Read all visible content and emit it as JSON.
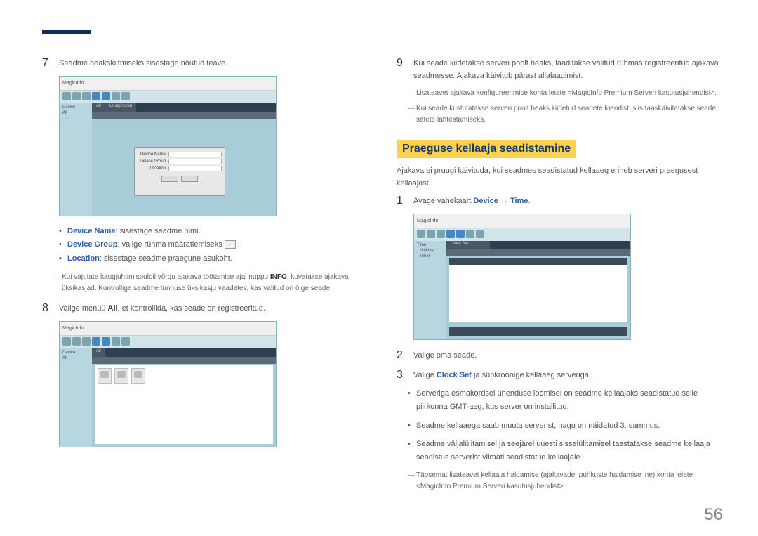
{
  "header": {},
  "left": {
    "step7": {
      "num": "7",
      "text": "Seadme heakskiitmiseks sisestage nõutud teave.",
      "bullets": {
        "b1_label": "Device Name",
        "b1_text": ": sisestage seadme nimi.",
        "b2_label": "Device Group",
        "b2_text": ": valige rühma määratlemiseks ",
        "b3_label": "Location",
        "b3_text": ": sisestage seadme praegune asukoht."
      },
      "note": "Kui vajutate kaugjuhtimispuldil võrgu ajakava töötamise ajal nuppu INFO, kuvatakse ajakava üksikasjad. Kontrollige seadme tunnuse üksikasju vaadates, kas valitud on õige seade.",
      "note_bold": "INFO"
    },
    "step8": {
      "num": "8",
      "text_a": "Valige menüü ",
      "bold": "All",
      "text_b": ", et kontrollida, kas seade on registreeritud."
    },
    "shot_app": "MagicInfo"
  },
  "right": {
    "step9": {
      "num": "9",
      "text_a": "Kui seade kiidetakse serveri poolt heaks, laaditakse valitud rühmas registreeritud ajakava seadmesse. Ajakava käivitub pärast allalaadimist.",
      "note1": "Lisateavet ajakava konfigureerimise kohta leiate <MagicInfo Premium Serveri kasutusjuhendist>.",
      "note2": "Kui seade kustutatakse serveri poolt heaks kiidetud seadete loendist, siis taaskäivitatakse seade sätete lähtestamiseks."
    },
    "heading": "Praeguse kellaaja seadistamine",
    "intro": "Ajakava ei pruugi käivituda, kui seadmes seadistatud kellaaeg erineb serveri praegusest kellaajast.",
    "step1": {
      "num": "1",
      "text_a": "Avage vahekaart ",
      "label1": "Device",
      "arrow": "→",
      "label2": "Time",
      "dot": "."
    },
    "step2": {
      "num": "2",
      "text": "Valige oma seade."
    },
    "step3": {
      "num": "3",
      "text_a": "Valige ",
      "label": "Clock Set",
      "text_b": " ja sünkroonige kellaaeg serveriga."
    },
    "sub_bullets": {
      "b1": "Serveriga esmakordsel ühenduse loomisel on seadme kellaajaks seadistatud selle piirkonna GMT-aeg, kus server on installitud.",
      "b2": "Seadme kellaaega saab muuta serverist, nagu on näidatud 3. sammus.",
      "b3": "Seadme väljalülitamisel ja seejärel uuesti sisselülitamisel taastatakse seadme kellaaja seadistus serverist viimati seadistatud kellaajale."
    },
    "note3": "Täpsemat lisateavet kellaaja haldamise (ajakavade, puhkuste haldamise jne) kohta leiate <MagicInfo Premium Serveri kasutusjuhendist>."
  },
  "page_num": "56"
}
